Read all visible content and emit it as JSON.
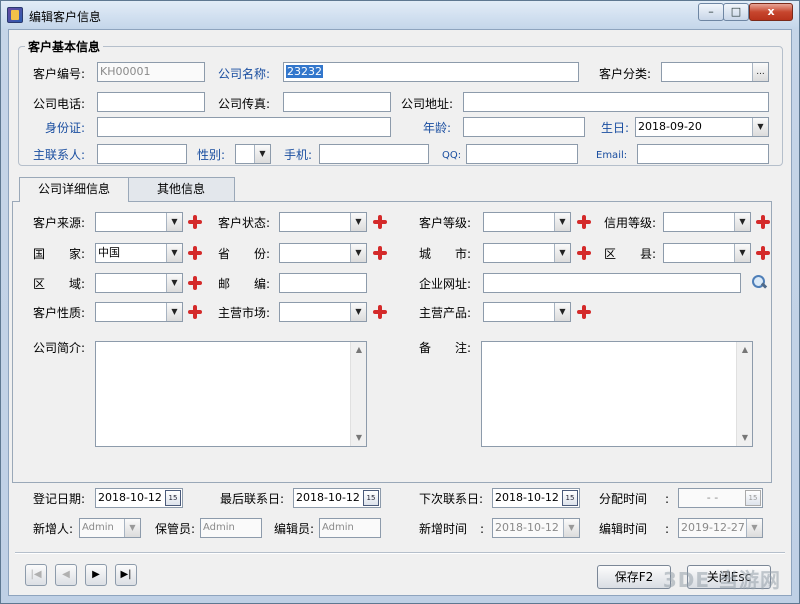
{
  "window": {
    "title": "编辑客户信息",
    "min_label": "–",
    "max_label": "□",
    "close_label": "x"
  },
  "basic": {
    "section_title": "客户基本信息",
    "customer_no_label": "客户编号:",
    "customer_no_value": "KH00001",
    "company_name_label": "公司名称:",
    "company_name_value": "23232",
    "category_label": "客户分类:",
    "category_button": "...",
    "phone_label": "公司电话:",
    "fax_label": "公司传真:",
    "address_label": "公司地址:",
    "id_card_label": "身份证:",
    "age_label": "年龄:",
    "birthday_label": "生日:",
    "birthday_value": "2018-09-20",
    "contact_label": "主联系人:",
    "gender_label": "性别:",
    "mobile_label": "手机:",
    "qq_label": "QQ:",
    "email_label": "Email:"
  },
  "tabs": [
    {
      "label": "公司详细信息",
      "active": true
    },
    {
      "label": "其他信息",
      "active": false
    }
  ],
  "detail": {
    "source_label": "客户来源:",
    "status_label": "客户状态:",
    "level_label": "客户等级:",
    "credit_label": "信用等级:",
    "country_label": "国　　家:",
    "country_value": "中国",
    "province_label": "省　　份:",
    "city_label": "城　　市:",
    "county_label": "区　　县:",
    "region_label": "区　　域:",
    "postcode_label": "邮　　编:",
    "website_label": "企业网址:",
    "nature_label": "客户性质:",
    "market_label": "主营市场:",
    "product_label": "主营产品:",
    "intro_label": "公司简介:",
    "remark_label": "备　　注:"
  },
  "footer": {
    "reg_date_label": "登记日期:",
    "reg_date_value": "2018-10-12",
    "last_contact_label": "最后联系日:",
    "last_contact_value": "2018-10-12",
    "next_contact_label": "下次联系日:",
    "next_contact_value": "2018-10-12",
    "assign_time_label": "分配时间",
    "assign_time_value": "-  -",
    "creator_label": "新增人:",
    "creator_value": "Admin",
    "keeper_label": "保管员:",
    "keeper_value": "Admin",
    "editor_label": "编辑员:",
    "editor_value": "Admin",
    "create_time_label": "新增时间",
    "create_time_value": "2018-10-12",
    "edit_time_label": "编辑时间",
    "edit_time_value": "2019-12-27",
    "colon": ":",
    "cal_glyph": "15"
  },
  "nav": {
    "first": "|◀",
    "prev": "◀",
    "next": "▶",
    "last": "▶|"
  },
  "buttons": {
    "save": "保存F2",
    "close": "关闭Esc"
  },
  "watermark": "3DE 当游网"
}
